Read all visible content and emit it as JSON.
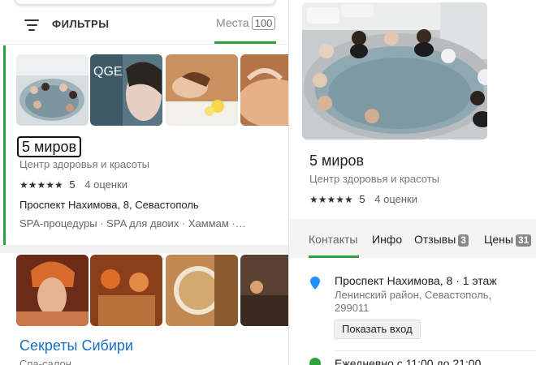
{
  "filters": {
    "label": "ФИЛЬТРЫ",
    "places_tab_label": "Места",
    "places_count": "100"
  },
  "cards": [
    {
      "title": "5 миров",
      "subtitle": "Центр здоровья и красоты",
      "stars": "★★★★★",
      "rating": "5",
      "reviews": "4 оценки",
      "address": "Проспект Нахимова, 8, Севастополь",
      "tags": "SPA-процедуры · SPA для двоих · Хаммам ·…",
      "thumbnail_text": "QGE"
    },
    {
      "title": "Секреты Сибири",
      "subtitle": "Спа-салон"
    }
  ],
  "detail": {
    "title": "5 миров",
    "subtitle": "Центр здоровья и красоты",
    "stars": "★★★★★",
    "rating": "5",
    "reviews": "4 оценки",
    "tabs": [
      {
        "label": "Контакты"
      },
      {
        "label": "Инфо"
      },
      {
        "label": "Отзывы",
        "count": "3"
      },
      {
        "label": "Цены",
        "count": "31"
      }
    ],
    "address_line1": "Проспект Нахимова, 8 · 1 этаж",
    "address_line2": "Ленинский район, Севастополь, 299011",
    "entrance_button": "Показать вход",
    "hours": "Ежедневно с 11:00 до 21:00"
  },
  "colors": {
    "accent": "#2aa33a",
    "link": "#1a6fc4",
    "location_pin": "#1e90ff"
  }
}
